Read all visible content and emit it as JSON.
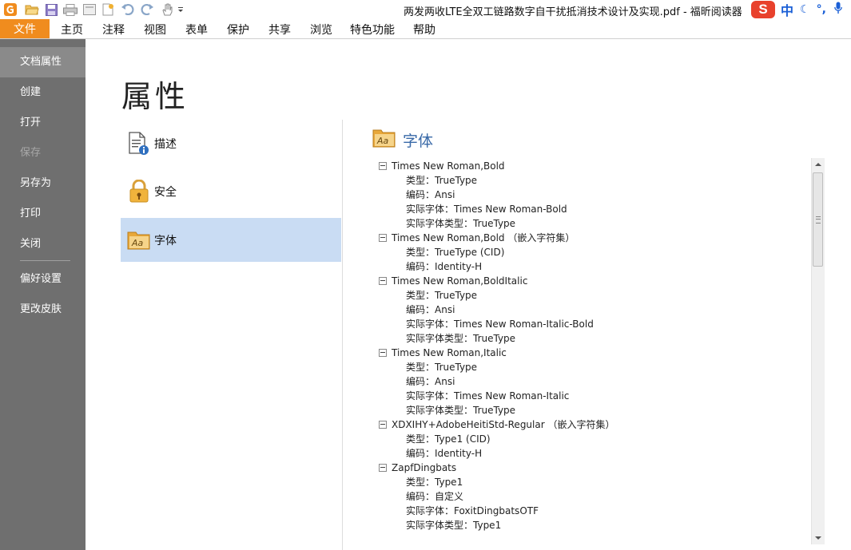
{
  "window": {
    "title": "两发两收LTE全双工链路数字自干扰抵消技术设计及实现.pdf - 福昕阅读器"
  },
  "quick_access": {
    "icons": [
      "app-logo-icon",
      "open-folder-icon",
      "save-icon",
      "print-icon",
      "scan-icon",
      "new-document-icon",
      "undo-icon",
      "redo-icon",
      "hand-tool-icon",
      "customize-dropdown-icon"
    ]
  },
  "ime": {
    "logo": "S",
    "mode": "中",
    "moon": "☾",
    "punct": "°,"
  },
  "menu": {
    "file": "文件",
    "items": [
      "主页",
      "注释",
      "视图",
      "表单",
      "保护",
      "共享",
      "浏览",
      "特色功能",
      "帮助"
    ]
  },
  "sidebar": {
    "items": [
      {
        "label": "文档属性",
        "state": "active"
      },
      {
        "label": "创建",
        "state": "normal"
      },
      {
        "label": "打开",
        "state": "normal"
      },
      {
        "label": "保存",
        "state": "disabled"
      },
      {
        "label": "另存为",
        "state": "normal"
      },
      {
        "label": "打印",
        "state": "normal"
      },
      {
        "label": "关闭",
        "state": "normal"
      },
      {
        "label": "偏好设置",
        "state": "normal"
      },
      {
        "label": "更改皮肤",
        "state": "normal"
      }
    ]
  },
  "page": {
    "title": "属性"
  },
  "property_tabs": [
    {
      "label": "描述",
      "icon": "document-info-icon",
      "selected": false
    },
    {
      "label": "安全",
      "icon": "padlock-icon",
      "selected": false
    },
    {
      "label": "字体",
      "icon": "font-folder-icon",
      "selected": true
    }
  ],
  "section": {
    "title": "字体",
    "icon_text": "Aa"
  },
  "fonts": [
    {
      "name": "Times New Roman,Bold",
      "props": [
        "类型：TrueType",
        "编码：Ansi",
        "实际字体：Times New Roman-Bold",
        "实际字体类型：TrueType"
      ]
    },
    {
      "name": "Times New Roman,Bold （嵌入字符集）",
      "props": [
        "类型：TrueType (CID)",
        "编码：Identity-H"
      ]
    },
    {
      "name": "Times New Roman,BoldItalic",
      "props": [
        "类型：TrueType",
        "编码：Ansi",
        "实际字体：Times New Roman-Italic-Bold",
        "实际字体类型：TrueType"
      ]
    },
    {
      "name": "Times New Roman,Italic",
      "props": [
        "类型：TrueType",
        "编码：Ansi",
        "实际字体：Times New Roman-Italic",
        "实际字体类型：TrueType"
      ]
    },
    {
      "name": "XDXIHY+AdobeHeitiStd-Regular （嵌入字符集）",
      "props": [
        "类型：Type1 (CID)",
        "编码：Identity-H"
      ]
    },
    {
      "name": "ZapfDingbats",
      "props": [
        "类型：Type1",
        "编码：自定义",
        "实际字体：FoxitDingbatsOTF",
        "实际字体类型：Type1"
      ]
    }
  ],
  "colors": {
    "file_tab": "#f08c1e",
    "sidebar_bg": "#6f6f6f",
    "sidebar_active": "#8a8a8a",
    "selected_tab": "#c9dcf3",
    "section_title": "#3a6aa8"
  }
}
